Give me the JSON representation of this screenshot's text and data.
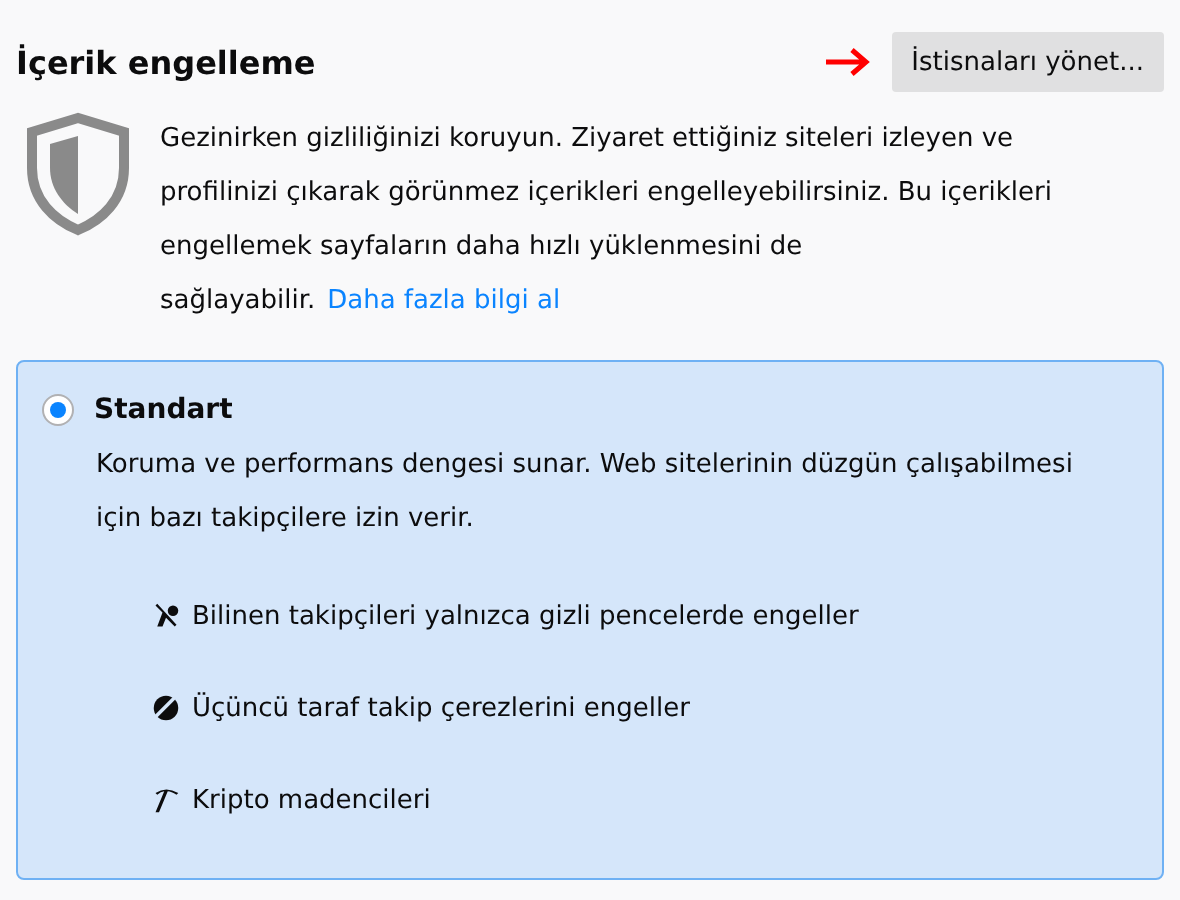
{
  "section": {
    "title": "İçerik engelleme",
    "button": "İstisnaları yönet...",
    "description": "Gezinirken gizliliğinizi koruyun. Ziyaret ettiğiniz siteleri izleyen ve profilinizi çıkarak görünmez içerikleri engelleyebilirsiniz. Bu içerikleri engellemek sayfaların daha hızlı yüklenmesini de sağlayabilir.",
    "link": "Daha fazla bilgi al"
  },
  "option": {
    "label": "Standart",
    "selected": true,
    "description": "Koruma ve performans dengesi sunar. Web sitelerinin düzgün çalışabilmesi için bazı takipçilere izin verir.",
    "items": [
      {
        "kind": "tracker",
        "text": "Bilinen takipçileri yalnızca gizli pencelerde engeller"
      },
      {
        "kind": "cookie",
        "text": "Üçüncü taraf takip çerezlerini engeller"
      },
      {
        "kind": "miner",
        "text": "Kripto madencileri"
      }
    ]
  }
}
